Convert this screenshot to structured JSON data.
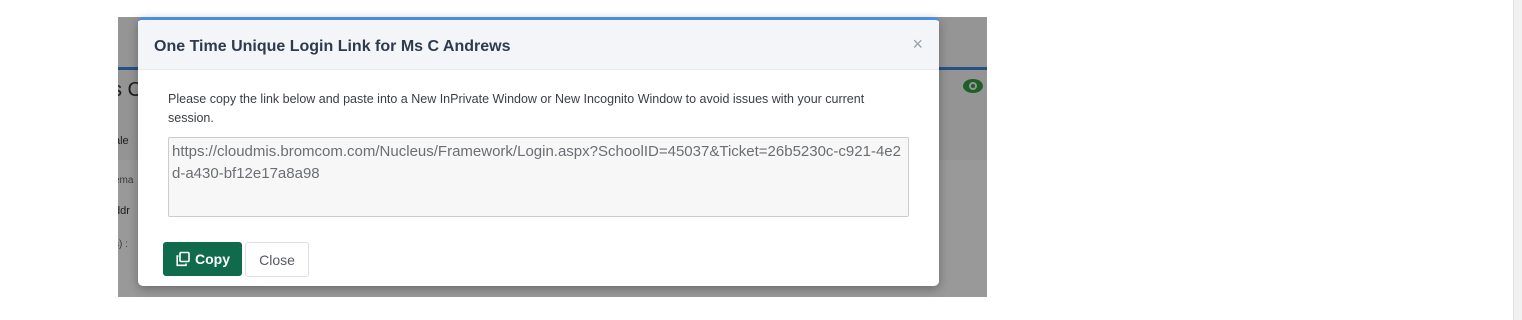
{
  "background": {
    "title_fragment": "s C",
    "field_1": "ale",
    "field_2": "ema",
    "field_3": "ddr",
    "field_4": "s) :"
  },
  "modal": {
    "title": "One Time Unique Login Link for Ms C Andrews",
    "close_glyph": "×",
    "instructions": "Please copy the link below and paste into a New InPrivate Window or New Incognito Window to avoid issues with your current session.",
    "link_value": "https://cloudmis.bromcom.com/Nucleus/Framework/Login.aspx?SchoolID=45037&Ticket=26b5230c-c921-4e2d-a430-bf12e17a8a98",
    "copy_label": "Copy",
    "close_label": "Close"
  },
  "colors": {
    "accent_blue": "#4a8fdc",
    "copy_button_green": "#0f6b4c",
    "eye_icon_green": "#2e8b3e"
  },
  "icons": {
    "copy": "copy-icon",
    "close": "close-icon",
    "eye": "eye-icon"
  }
}
